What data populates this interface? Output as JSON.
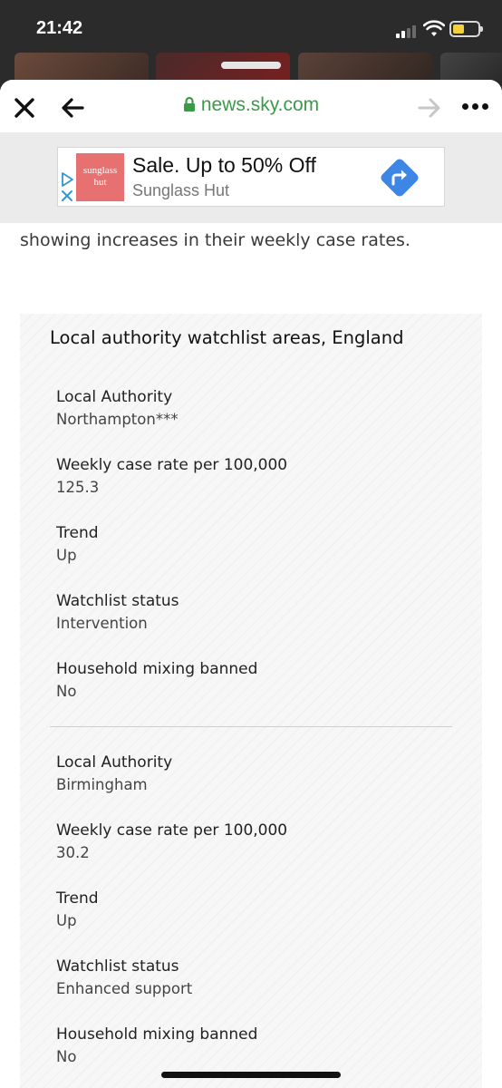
{
  "status_bar": {
    "time": "21:42"
  },
  "browser": {
    "url": "news.sky.com",
    "icons": {
      "close": "close-icon",
      "back": "arrow-left-icon",
      "lock": "lock-icon",
      "forward": "arrow-right-icon",
      "more": "more-horizontal-icon"
    },
    "url_color": "#3a9a48"
  },
  "ad": {
    "brand_logo_text": "sunglass hut",
    "headline": "Sale. Up to 50% Off",
    "advertiser": "Sunglass Hut",
    "brand_color": "#e67170",
    "cta_color": "#3d86e6",
    "icons": {
      "choices": "ad-choices-icon",
      "cta": "directions-icon"
    }
  },
  "article": {
    "lead_text": "showing increases in their weekly case rates."
  },
  "table": {
    "title": "Local authority watchlist areas, England",
    "records": [
      {
        "fields": [
          {
            "label": "Local Authority",
            "value": "Northampton***"
          },
          {
            "label": "Weekly case rate per 100,000",
            "value": "125.3"
          },
          {
            "label": "Trend",
            "value": "Up"
          },
          {
            "label": "Watchlist status",
            "value": "Intervention"
          },
          {
            "label": "Household mixing banned",
            "value": "No"
          }
        ]
      },
      {
        "fields": [
          {
            "label": "Local Authority",
            "value": "Birmingham"
          },
          {
            "label": "Weekly case rate per 100,000",
            "value": "30.2"
          },
          {
            "label": "Trend",
            "value": "Up"
          },
          {
            "label": "Watchlist status",
            "value": "Enhanced support"
          },
          {
            "label": "Household mixing banned",
            "value": "No"
          }
        ]
      }
    ]
  }
}
